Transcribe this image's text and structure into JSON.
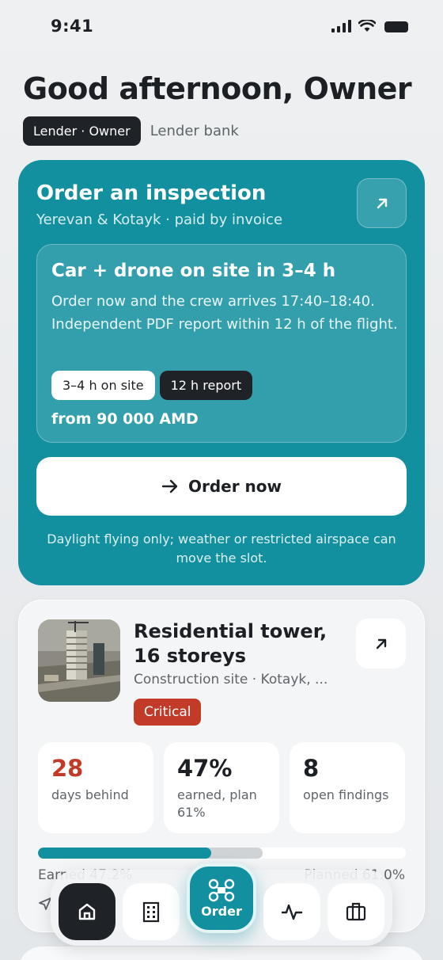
{
  "status_bar": {
    "time": "9:41"
  },
  "header": {
    "greeting": "Good afternoon, Owner",
    "role_chip": "Lender · Owner",
    "role_subtitle": "Lender bank"
  },
  "order_card": {
    "title": "Order an inspection",
    "subtitle": "Yerevan & Kotayk · paid by invoice",
    "offer": {
      "title": "Car + drone on site in 3–4 h",
      "description": "Order now and the crew arrives 17:40–18:40. Independent PDF report within 12 h of the flight.",
      "tags": [
        "3–4 h on site",
        "12 h report"
      ],
      "price": "from 90 000 AMD"
    },
    "cta_label": "Order now",
    "disclaimer": "Daylight flying only; weather or restricted airspace can move the slot."
  },
  "project_card": {
    "title": "Residential tower, 16 storeys",
    "subtitle": "Construction site · Kotayk, ...",
    "status_badge": "Critical",
    "stats": [
      {
        "value": "28",
        "label": "days behind"
      },
      {
        "value": "47%",
        "label": "earned, plan 61%"
      },
      {
        "value": "8",
        "label": "open findings"
      }
    ],
    "progress": {
      "earned": 47.2,
      "planned": 61.0,
      "earned_label": "Earned 47.2%",
      "planned_label": "Planned 61.0%"
    }
  },
  "bottom_nav": {
    "items": [
      {
        "icon": "home-icon",
        "active": true
      },
      {
        "icon": "building-icon"
      },
      {
        "icon": "drone-icon",
        "label": "Order"
      },
      {
        "icon": "activity-icon"
      },
      {
        "icon": "briefcase-icon"
      }
    ]
  },
  "colors": {
    "accent": "#13909f",
    "critical": "#c23b28",
    "dark": "#1f2327"
  }
}
